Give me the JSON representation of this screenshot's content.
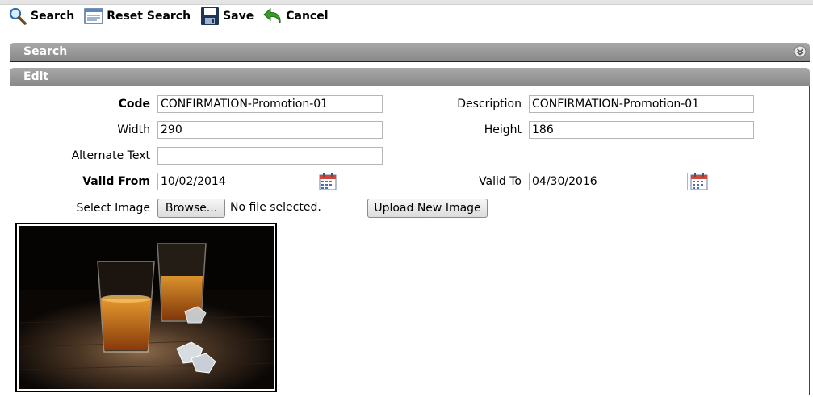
{
  "toolbar": {
    "search_label": "Search",
    "reset_label": "Reset Search",
    "save_label": "Save",
    "cancel_label": "Cancel"
  },
  "panels": {
    "search_title": "Search",
    "edit_title": "Edit"
  },
  "form": {
    "code_label": "Code",
    "code_value": "CONFIRMATION-Promotion-01",
    "description_label": "Description",
    "description_value": "CONFIRMATION-Promotion-01",
    "width_label": "Width",
    "width_value": "290",
    "height_label": "Height",
    "height_value": "186",
    "alt_text_label": "Alternate Text",
    "alt_text_value": "",
    "valid_from_label": "Valid From",
    "valid_from_value": "10/02/2014",
    "valid_to_label": "Valid To",
    "valid_to_value": "04/30/2016",
    "select_image_label": "Select Image",
    "browse_label": "Browse...",
    "no_file_text": "No file selected.",
    "upload_label": "Upload New Image"
  },
  "icons": {
    "search": "magnifier-icon",
    "reset": "reset-form-icon",
    "save": "floppy-disk-icon",
    "cancel": "undo-arrow-icon",
    "collapse": "chevron-down-circle-icon",
    "calendar": "calendar-icon"
  },
  "colors": {
    "panel_bar": "#999999",
    "cancel_green": "#3a9a2a",
    "save_navy": "#1f3556"
  }
}
